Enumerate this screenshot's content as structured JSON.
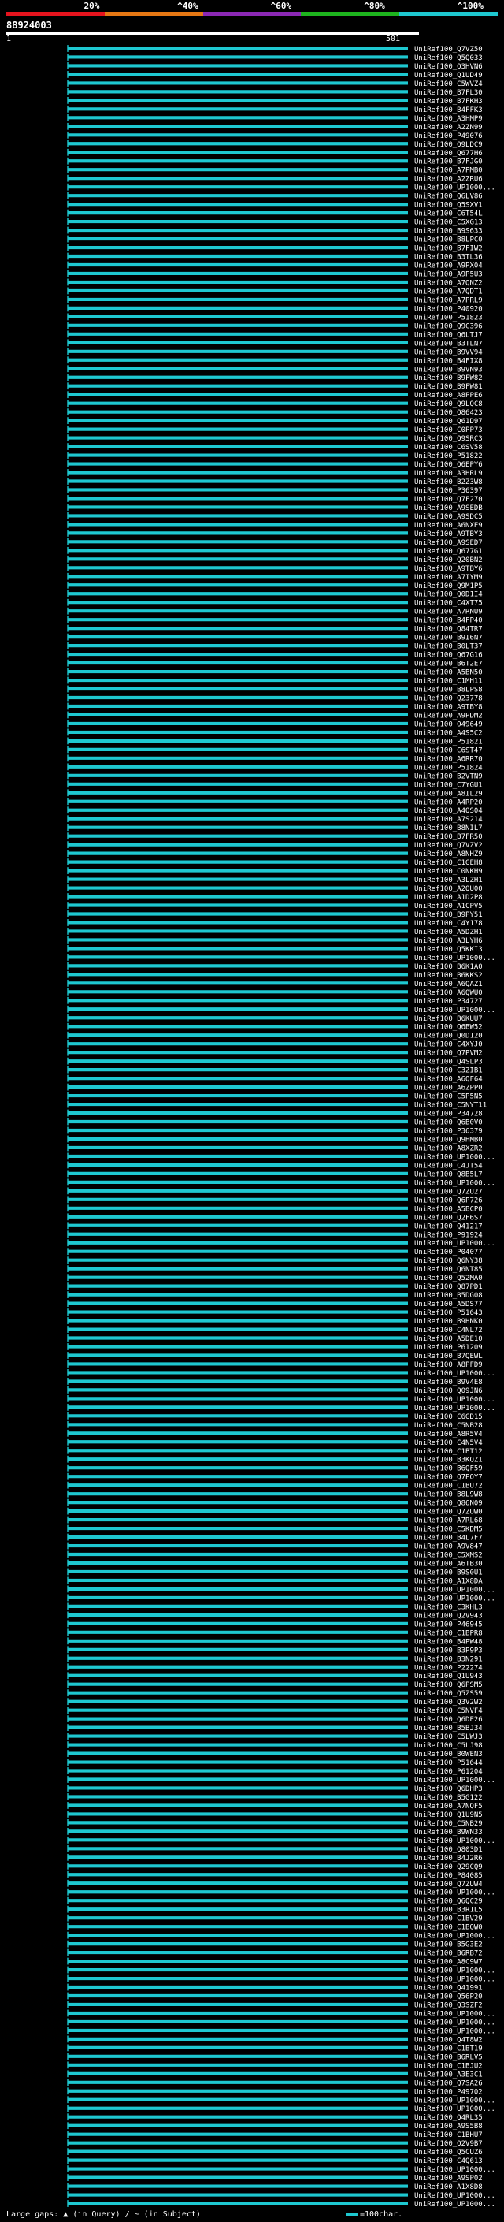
{
  "coverage_scale": {
    "segments": [
      {
        "color": "#e6141e"
      },
      {
        "color": "#e67814"
      },
      {
        "color": "#8c28b4"
      },
      {
        "color": "#1eb41e"
      },
      {
        "color": "#1ec8d0"
      }
    ],
    "ticks": [
      {
        "label": "20%",
        "pos": 0.19
      },
      {
        "label": "^40%",
        "pos": 0.38
      },
      {
        "label": "^60%",
        "pos": 0.57
      },
      {
        "label": "^80%",
        "pos": 0.76
      },
      {
        "label": "^100%",
        "pos": 0.95
      }
    ]
  },
  "query": {
    "id": "88924003",
    "start": "1",
    "end": "501"
  },
  "hit_color": "#1ec8d0",
  "hits": [
    "UniRef100_Q7VZ50",
    "UniRef100_Q5Q033",
    "UniRef100_Q3HVN6",
    "UniRef100_Q1UD49",
    "UniRef100_C5WVZ4",
    "UniRef100_B7FL30",
    "UniRef100_B7FKH3",
    "UniRef100_B4FFK3",
    "UniRef100_A3HMP9",
    "UniRef100_A2ZN99",
    "UniRef100_P49076",
    "UniRef100_Q9LDC9",
    "UniRef100_Q677H6",
    "UniRef100_B7FJG0",
    "UniRef100_A7PMB0",
    "UniRef100_A2ZRU6",
    "UniRef100_UP1000...",
    "UniRef100_Q6LV86",
    "UniRef100_Q5SXV1",
    "UniRef100_C6T54L",
    "UniRef100_C5XG13",
    "UniRef100_B9S633",
    "UniRef100_B8LPC0",
    "UniRef100_B7FIW2",
    "UniRef100_B3TL36",
    "UniRef100_A9PX04",
    "UniRef100_A9P5U3",
    "UniRef100_A7QNZ2",
    "UniRef100_A7QDT1",
    "UniRef100_A7PRL9",
    "UniRef100_P40920",
    "UniRef100_P51823",
    "UniRef100_Q9C396",
    "UniRef100_Q6LTJ7",
    "UniRef100_B3TLN7",
    "UniRef100_B9VV94",
    "UniRef100_B4FIX8",
    "UniRef100_B9VN93",
    "UniRef100_B9FW82",
    "UniRef100_B9FW81",
    "UniRef100_A8PPE6",
    "UniRef100_Q9LQC8",
    "UniRef100_Q86423",
    "UniRef100_Q61D97",
    "UniRef100_C0PP73",
    "UniRef100_Q9SRC3",
    "UniRef100_C6SV58",
    "UniRef100_P51822",
    "UniRef100_Q6EPY6",
    "UniRef100_A3HRL9",
    "UniRef100_B2Z3W8",
    "UniRef100_P36397",
    "UniRef100_Q7F270",
    "UniRef100_A9SEDB",
    "UniRef100_A9SDC5",
    "UniRef100_A6NXE9",
    "UniRef100_A9TBY3",
    "UniRef100_A9SED7",
    "UniRef100_Q677G1",
    "UniRef100_Q20BN2",
    "UniRef100_A9TBY6",
    "UniRef100_A7IYM9",
    "UniRef100_Q9M1P5",
    "UniRef100_Q0D1I4",
    "UniRef100_C4XT75",
    "UniRef100_A7RNU9",
    "UniRef100_B4FP40",
    "UniRef100_Q84TR7",
    "UniRef100_B9I6N7",
    "UniRef100_B0LT37",
    "UniRef100_Q67G16",
    "UniRef100_B6T2E7",
    "UniRef100_A5BN50",
    "UniRef100_C1MH11",
    "UniRef100_B8LPS8",
    "UniRef100_Q23778",
    "UniRef100_A9TBY8",
    "UniRef100_A9PDM2",
    "UniRef100_O49649",
    "UniRef100_A4S5C2",
    "UniRef100_P51821",
    "UniRef100_C6ST47",
    "UniRef100_A6RR70",
    "UniRef100_P51824",
    "UniRef100_B2VTN9",
    "UniRef100_C7YGU1",
    "UniRef100_A8IL29",
    "UniRef100_A4RP20",
    "UniRef100_A4QS04",
    "UniRef100_A7S214",
    "UniRef100_B8NIL7",
    "UniRef100_B7FR50",
    "UniRef100_Q7VZV2",
    "UniRef100_A8NHZ9",
    "UniRef100_C1GEH8",
    "UniRef100_C0NKH9",
    "UniRef100_A3LZH1",
    "UniRef100_A2QU00",
    "UniRef100_A1D2P8",
    "UniRef100_A1CPV5",
    "UniRef100_B9PY51",
    "UniRef100_C4Y178",
    "UniRef100_A5DZH1",
    "UniRef100_A3LYH6",
    "UniRef100_Q5KKI3",
    "UniRef100_UP1000...",
    "UniRef100_B6K1A0",
    "UniRef100_B6KKS2",
    "UniRef100_A6QAZ1",
    "UniRef100_A6QWU0",
    "UniRef100_P34727",
    "UniRef100_UP1000...",
    "UniRef100_B6KUU7",
    "UniRef100_Q6BW52",
    "UniRef100_Q0D120",
    "UniRef100_C4XYJ0",
    "UniRef100_Q7PVM2",
    "UniRef100_Q4SLP3",
    "UniRef100_C3ZIB1",
    "UniRef100_A6QF64",
    "UniRef100_A6ZPP0",
    "UniRef100_C5P5N5",
    "UniRef100_C5NYT11",
    "UniRef100_P34728",
    "UniRef100_Q6B0V0",
    "UniRef100_P36379",
    "UniRef100_Q9HMB0",
    "UniRef100_A8XZR2",
    "UniRef100_UP1000...",
    "UniRef100_C4JT54",
    "UniRef100_Q8B5L7",
    "UniRef100_UP1000...",
    "UniRef100_Q7ZU27",
    "UniRef100_Q6P726",
    "UniRef100_A5BCP0",
    "UniRef100_Q2F6S7",
    "UniRef100_Q41217",
    "UniRef100_P91924",
    "UniRef100_UP1000...",
    "UniRef100_P04077",
    "UniRef100_Q6NY38",
    "UniRef100_Q6NT85",
    "UniRef100_Q52MA0",
    "UniRef100_Q87PD1",
    "UniRef100_B5DG08",
    "UniRef100_A5DS77",
    "UniRef100_P51643",
    "UniRef100_B9HNK0",
    "UniRef100_C4NL72",
    "UniRef100_A5DE10",
    "UniRef100_P61209",
    "UniRef100_B7QEWL",
    "UniRef100_A8PFD9",
    "UniRef100_UP1000...",
    "UniRef100_B9V4E8",
    "UniRef100_Q09JN6",
    "UniRef100_UP1000...",
    "UniRef100_UP1000...",
    "UniRef100_C6GD15",
    "UniRef100_C5NB28",
    "UniRef100_A8R5V4",
    "UniRef100_C4N5V4",
    "UniRef100_C1BT12",
    "UniRef100_B3KQZ1",
    "UniRef100_B6QF59",
    "UniRef100_Q7PQY7",
    "UniRef100_C1BU72",
    "UniRef100_B8L9W8",
    "UniRef100_Q86N09",
    "UniRef100_Q7ZUW0",
    "UniRef100_A7RL68",
    "UniRef100_C5KDM5",
    "UniRef100_B4L7F7",
    "UniRef100_A9V847",
    "UniRef100_C5XMS2",
    "UniRef100_A6TB30",
    "UniRef100_B9S0U1",
    "UniRef100_A1X8DA",
    "UniRef100_UP1000...",
    "UniRef100_UP1000...",
    "UniRef100_C3KHL3",
    "UniRef100_Q2V943",
    "UniRef100_P46945",
    "UniRef100_C1BPR8",
    "UniRef100_B4PW48",
    "UniRef100_B3P9P3",
    "UniRef100_B3N291",
    "UniRef100_P22274",
    "UniRef100_Q1U943",
    "UniRef100_Q6PSM5",
    "UniRef100_Q5ZS59",
    "UniRef100_Q3V2W2",
    "UniRef100_C5NVF4",
    "UniRef100_Q6DE26",
    "UniRef100_B5BJ34",
    "UniRef100_C5LWJ3",
    "UniRef100_C5LJ98",
    "UniRef100_B0WEN3",
    "UniRef100_P51644",
    "UniRef100_P61204",
    "UniRef100_UP1000...",
    "UniRef100_Q6DHP3",
    "UniRef100_B5G122",
    "UniRef100_A7NQF5",
    "UniRef100_Q1U9N5",
    "UniRef100_C5NB29",
    "UniRef100_B9WN33",
    "UniRef100_UP1000...",
    "UniRef100_Q803D1",
    "UniRef100_B4J2R6",
    "UniRef100_Q29CQ9",
    "UniRef100_P84085",
    "UniRef100_Q7ZUW4",
    "UniRef100_UP1000...",
    "UniRef100_Q6QC29",
    "UniRef100_B3R1L5",
    "UniRef100_C1BV29",
    "UniRef100_C1BQW0",
    "UniRef100_UP1000...",
    "UniRef100_B5G3E2",
    "UniRef100_B6RB72",
    "UniRef100_A8C9W7",
    "UniRef100_UP1000...",
    "UniRef100_UP1000...",
    "UniRef100_Q41991",
    "UniRef100_Q56P20",
    "UniRef100_Q3SZF2",
    "UniRef100_UP1000...",
    "UniRef100_UP1000...",
    "UniRef100_UP1000...",
    "UniRef100_Q4T8W2",
    "UniRef100_C1BT19",
    "UniRef100_B6RLV5",
    "UniRef100_C1BJU2",
    "UniRef100_A3E3C1",
    "UniRef100_Q7SA26",
    "UniRef100_P49702",
    "UniRef100_UP1000...",
    "UniRef100_UP1000...",
    "UniRef100_Q4RL35",
    "UniRef100_A9S5B8",
    "UniRef100_C1BHU7",
    "UniRef100_Q2V9B7",
    "UniRef100_Q5CUZ6",
    "UniRef100_C4Q613",
    "UniRef100_UP1000...",
    "UniRef100_A9SP02",
    "UniRef100_A1X8D8",
    "UniRef100_UP1000...",
    "UniRef100_UP1000..."
  ],
  "footer": {
    "large_gaps_label": "Large gaps:",
    "query_gap_glyph": "▲",
    "query_gap_text": "(in Query)",
    "subject_gap_glyph": "/ ~",
    "subject_gap_text": "(in Subject)",
    "scale_text": "=100char."
  }
}
